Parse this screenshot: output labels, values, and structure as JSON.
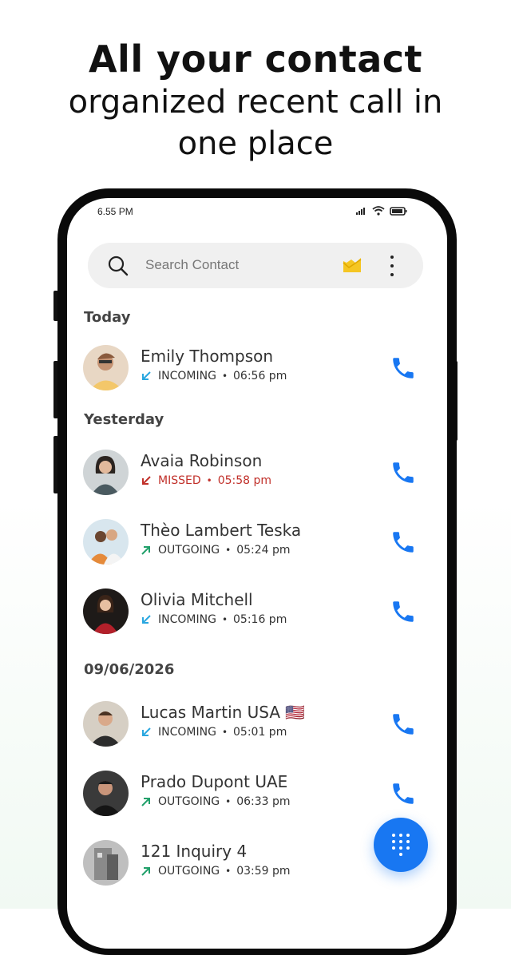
{
  "headline": {
    "line1": "All your contact",
    "line2": "organized recent call in",
    "line3": "one place"
  },
  "status_bar": {
    "time": "6.55 PM",
    "icons": [
      "signal-icon",
      "wifi-icon",
      "battery-icon"
    ]
  },
  "search": {
    "placeholder": "Search Contact",
    "icons": [
      "search-icon",
      "folder-icon",
      "more-vert-icon"
    ]
  },
  "colors": {
    "accent": "#1877f2",
    "incoming": "#2aa7e0",
    "outgoing": "#22a06b",
    "missed": "#c1302a"
  },
  "sections": [
    {
      "label": "Today",
      "calls": [
        {
          "name": "Emily Thompson",
          "type": "INCOMING",
          "time": "06:56 pm"
        }
      ]
    },
    {
      "label": "Yesterday",
      "calls": [
        {
          "name": "Avaia Robinson",
          "type": "MISSED",
          "time": "05:58 pm"
        },
        {
          "name": "Thèo Lambert Teska",
          "type": "OUTGOING",
          "time": "05:24 pm"
        },
        {
          "name": "Olivia Mitchell",
          "type": "INCOMING",
          "time": "05:16 pm"
        }
      ]
    },
    {
      "label": "09/06/2026",
      "calls": [
        {
          "name": "Lucas Martin USA 🇺🇸",
          "type": "INCOMING",
          "time": "05:01 pm"
        },
        {
          "name": "Prado Dupont UAE",
          "type": "OUTGOING",
          "time": "06:33 pm"
        },
        {
          "name": "121 Inquiry 4",
          "type": "OUTGOING",
          "time": "03:59 pm"
        }
      ]
    }
  ],
  "fab": {
    "icon": "dialpad-icon"
  }
}
